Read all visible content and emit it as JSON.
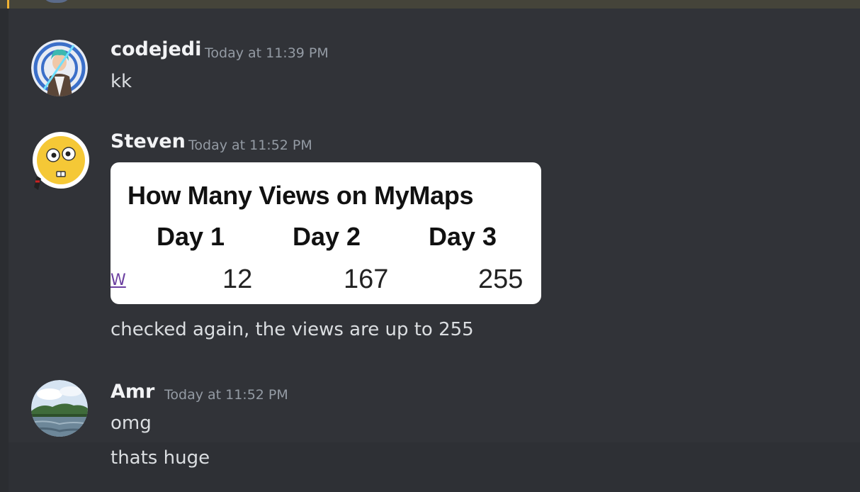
{
  "messages": [
    {
      "username": "codejedi",
      "timestamp": "Today at 11:39 PM",
      "lines": [
        "kk"
      ]
    },
    {
      "username": "Steven",
      "timestamp": "Today at 11:52 PM",
      "attachment": {
        "title": "How Many Views on MyMaps",
        "link_glyph": "W",
        "columns": [
          {
            "header": "Day 1",
            "value": "12"
          },
          {
            "header": "Day 2",
            "value": "167"
          },
          {
            "header": "Day 3",
            "value": "255"
          }
        ]
      },
      "lines": [
        "checked again, the views are up to 255"
      ]
    },
    {
      "username": "Amr",
      "timestamp": "Today at 11:52 PM",
      "lines": [
        "omg",
        "thats huge"
      ]
    }
  ],
  "colors": {
    "background": "#313338",
    "username": "#f2f3f5",
    "timestamp": "#949ba4",
    "message_text": "#dbdee1",
    "hover_background": "#2e3035"
  }
}
